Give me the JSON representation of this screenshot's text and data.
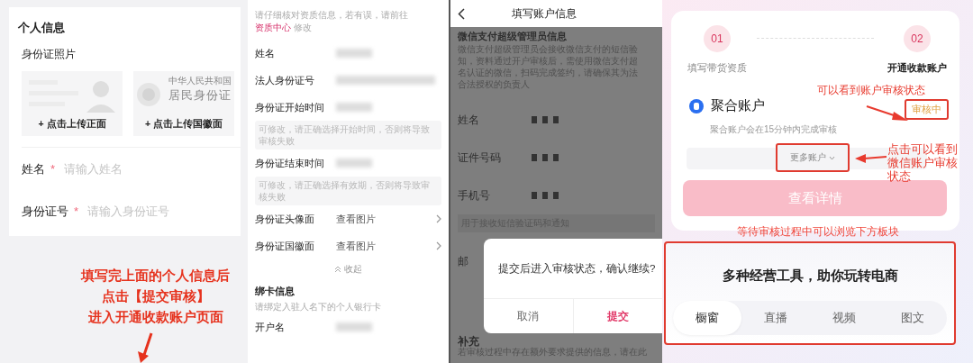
{
  "personal_info": {
    "title": "个人信息",
    "photo_label": "身份证照片",
    "upload_cards": [
      {
        "kind": "front",
        "plus": "+",
        "label": "点击上传正面"
      },
      {
        "kind": "emblem",
        "plus": "+",
        "label": "点击上传国徽面",
        "country": "中华人民共和国",
        "card_name": "居民身份证"
      }
    ],
    "fields": [
      {
        "label": "姓名",
        "required_mark": "*",
        "placeholder": "请输入姓名"
      },
      {
        "label": "身份证号",
        "required_mark": "*",
        "placeholder": "请输入身份证号"
      }
    ],
    "annotation": [
      "填写完上面的个人信息后",
      "点击【提交审核】",
      "进入开通收款账户页面"
    ]
  },
  "qualification": {
    "notice_before": "请仔细核对资质信息，若有误，请前往 ",
    "notice_link": "资质中心",
    "notice_after": " 修改",
    "rows": [
      {
        "kind": "blurred",
        "label": "姓名"
      },
      {
        "kind": "blurred",
        "label": "法人身份证号"
      },
      {
        "kind": "blurred",
        "label": "身份证开始时间",
        "hint": "可修改，请正确选择开始时间，否则将导致审核失败"
      },
      {
        "kind": "blurred",
        "label": "身份证结束时间",
        "hint": "可修改，请正确选择有效期，否则将导致审核失败"
      },
      {
        "kind": "link",
        "label": "身份证头像面",
        "value": "查看图片"
      },
      {
        "kind": "link",
        "label": "身份证国徽面",
        "value": "查看图片"
      }
    ],
    "collapse": "收起",
    "bank_title": "绑卡信息",
    "bank_subtitle": "请绑定入驻人名下的个人银行卡",
    "bank_rows": [
      {
        "kind": "blurred",
        "label": "开户名"
      }
    ]
  },
  "account_info": {
    "title": "填写账户信息",
    "section_title": "微信支付超级管理员信息",
    "description_lines": [
      "微信支付超级管理员会接收微信支付的短信验",
      "知，资料通过开户审核后，需使用微信支付超",
      "名认证的微信，扫码完成签约，请确保其为法",
      "合法授权的负责人"
    ],
    "rows": [
      {
        "label": "姓名"
      },
      {
        "label": "证件号码"
      },
      {
        "label": "手机号",
        "hint": "用于接收短信验证码和通知"
      }
    ],
    "email_label": "邮",
    "supplement_title": "补充",
    "supplement_text": "若审核过程中存在额外要求提供的信息，请在此",
    "dialog": {
      "message": "提交后进入审核状态，确认继续?",
      "buttons": [
        {
          "kind": "cancel",
          "label": "取消"
        },
        {
          "kind": "confirm",
          "label": "提交"
        }
      ]
    }
  },
  "payment_account": {
    "steps": [
      {
        "number": "01",
        "label": "填写带货资质",
        "current": false
      },
      {
        "number": "02",
        "label": "开通收款账户",
        "current": true
      }
    ],
    "account_name": "聚合账户",
    "account_status": "审核中",
    "account_note": "聚合账户会在15分钟内完成审核",
    "more_button": "更多账户",
    "details_button": "查看详情",
    "status_annotation": "可以看到账户审核状态",
    "more_annotation": [
      "点击可以看到",
      "微信账户审核",
      "状态"
    ],
    "browse_annotation": "等待审核过程中可以浏览下方板块",
    "tools_title": "多种经营工具，助你玩转电商",
    "tabs": [
      {
        "label": "橱窗",
        "selected": true
      },
      {
        "label": "直播",
        "selected": false
      },
      {
        "label": "视频",
        "selected": false
      },
      {
        "label": "图文",
        "selected": false
      }
    ]
  }
}
